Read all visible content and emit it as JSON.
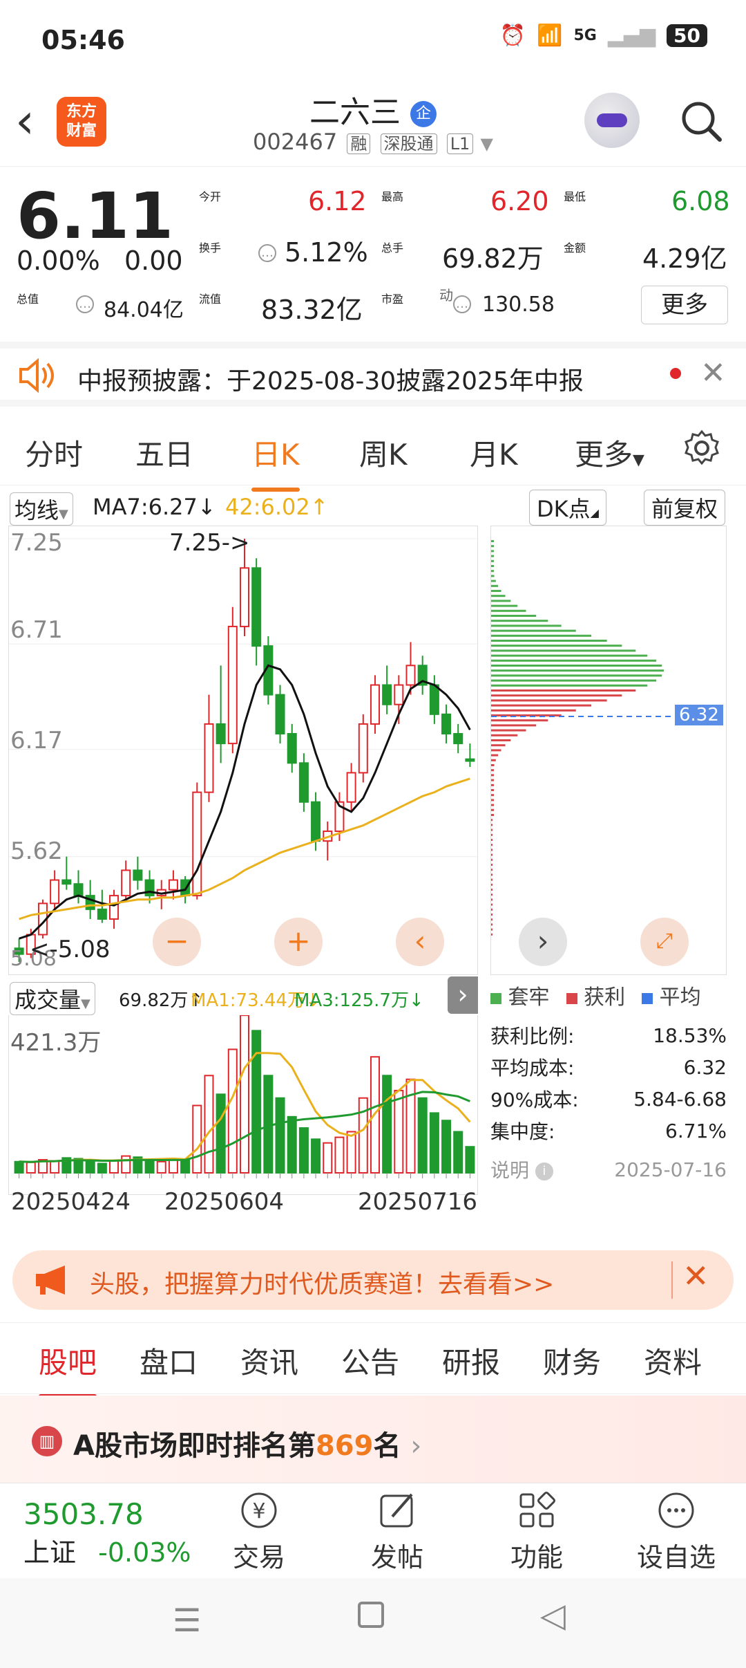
{
  "status": {
    "time": "05:46",
    "battery": "50",
    "network": "5G"
  },
  "header": {
    "back_icon": "back-chevron",
    "logo_text_1": "东方",
    "logo_text_2": "财富",
    "stock_name": "二六三",
    "stock_badge": "企",
    "code": "002467",
    "tags": [
      "融",
      "深股通",
      "L1"
    ]
  },
  "quote": {
    "price": "6.11",
    "change_pct": "0.00%",
    "change_val": "0.00",
    "open_label": "今开",
    "open": "6.12",
    "high_label": "最高",
    "high": "6.20",
    "low_label": "最低",
    "low": "6.08",
    "turnover_label": "换手",
    "turnover": "5.12%",
    "volume_label": "总手",
    "volume": "69.82万",
    "amount_label": "金额",
    "amount": "4.29亿",
    "mktcap_label": "总值",
    "mktcap": "84.04亿",
    "float_label": "流值",
    "float": "83.32亿",
    "pe_label": "市盈",
    "pe_sup": "动",
    "pe": "130.58",
    "more_label": "更多"
  },
  "notice": {
    "text": "中报预披露：于2025-08-30披露2025年中报"
  },
  "ktabs": [
    "分时",
    "五日",
    "日K",
    "周K",
    "月K",
    "更多"
  ],
  "ma_bar": {
    "selector": "均线",
    "ma7": "MA7:6.27",
    "ma7_arrow": "↓",
    "ma42": "42:6.02",
    "ma42_arrow": "↑",
    "dk_label": "DK点",
    "adj_label": "前复权"
  },
  "kchart": {
    "ticks": [
      "7.25",
      "6.71",
      "6.17",
      "5.62",
      "5.08"
    ],
    "high_mark": "7.25->",
    "low_mark": "<-5.08",
    "bottom_tick": "5.08"
  },
  "chart_data": [
    {
      "type": "candlestick",
      "title": "",
      "ylim": [
        5.08,
        7.25
      ],
      "dates_shown": [
        "20250424",
        "20250604",
        "20250716"
      ],
      "ohlc": [
        [
          5.15,
          5.2,
          5.08,
          5.12
        ],
        [
          5.12,
          5.25,
          5.1,
          5.22
        ],
        [
          5.22,
          5.4,
          5.2,
          5.38
        ],
        [
          5.38,
          5.55,
          5.35,
          5.5
        ],
        [
          5.5,
          5.62,
          5.45,
          5.48
        ],
        [
          5.48,
          5.55,
          5.38,
          5.42
        ],
        [
          5.42,
          5.5,
          5.3,
          5.35
        ],
        [
          5.35,
          5.45,
          5.28,
          5.3
        ],
        [
          5.3,
          5.45,
          5.25,
          5.42
        ],
        [
          5.42,
          5.6,
          5.4,
          5.55
        ],
        [
          5.55,
          5.62,
          5.45,
          5.5
        ],
        [
          5.5,
          5.55,
          5.38,
          5.42
        ],
        [
          5.42,
          5.5,
          5.35,
          5.45
        ],
        [
          5.45,
          5.55,
          5.4,
          5.5
        ],
        [
          5.5,
          5.52,
          5.38,
          5.42
        ],
        [
          5.42,
          6.0,
          5.4,
          5.95
        ],
        [
          5.95,
          6.45,
          5.9,
          6.3
        ],
        [
          6.3,
          6.6,
          6.1,
          6.2
        ],
        [
          6.2,
          6.9,
          6.15,
          6.8
        ],
        [
          6.8,
          7.25,
          6.75,
          7.1
        ],
        [
          7.1,
          7.15,
          6.6,
          6.7
        ],
        [
          6.7,
          6.75,
          6.4,
          6.45
        ],
        [
          6.45,
          6.5,
          6.2,
          6.25
        ],
        [
          6.25,
          6.3,
          6.05,
          6.1
        ],
        [
          6.1,
          6.15,
          5.85,
          5.9
        ],
        [
          5.9,
          5.95,
          5.65,
          5.7
        ],
        [
          5.7,
          5.8,
          5.6,
          5.75
        ],
        [
          5.75,
          5.95,
          5.7,
          5.9
        ],
        [
          5.9,
          6.1,
          5.85,
          6.05
        ],
        [
          6.05,
          6.35,
          6.0,
          6.3
        ],
        [
          6.3,
          6.55,
          6.25,
          6.5
        ],
        [
          6.5,
          6.6,
          6.35,
          6.4
        ],
        [
          6.4,
          6.55,
          6.3,
          6.5
        ],
        [
          6.5,
          6.72,
          6.45,
          6.6
        ],
        [
          6.6,
          6.65,
          6.45,
          6.5
        ],
        [
          6.5,
          6.55,
          6.3,
          6.35
        ],
        [
          6.35,
          6.4,
          6.2,
          6.25
        ],
        [
          6.25,
          6.3,
          6.15,
          6.2
        ],
        [
          6.12,
          6.2,
          6.08,
          6.11
        ]
      ],
      "ma7": [
        5.2,
        5.22,
        5.28,
        5.35,
        5.4,
        5.42,
        5.4,
        5.38,
        5.37,
        5.4,
        5.43,
        5.44,
        5.43,
        5.44,
        5.45,
        5.55,
        5.7,
        5.85,
        6.05,
        6.3,
        6.5,
        6.6,
        6.58,
        6.5,
        6.35,
        6.15,
        5.98,
        5.88,
        5.85,
        5.92,
        6.05,
        6.2,
        6.35,
        6.48,
        6.52,
        6.5,
        6.45,
        6.38,
        6.27
      ],
      "ma42": [
        5.3,
        5.32,
        5.33,
        5.34,
        5.35,
        5.36,
        5.37,
        5.37,
        5.38,
        5.39,
        5.4,
        5.4,
        5.41,
        5.41,
        5.42,
        5.43,
        5.45,
        5.48,
        5.51,
        5.55,
        5.58,
        5.61,
        5.64,
        5.66,
        5.68,
        5.7,
        5.72,
        5.74,
        5.76,
        5.78,
        5.81,
        5.84,
        5.87,
        5.9,
        5.93,
        5.95,
        5.98,
        6.0,
        6.02
      ]
    },
    {
      "type": "bar",
      "title": "成交量",
      "ylim": [
        0,
        421.3
      ],
      "unit": "万",
      "values": [
        30,
        28,
        35,
        32,
        40,
        38,
        30,
        25,
        33,
        45,
        42,
        35,
        30,
        38,
        36,
        180,
        260,
        210,
        330,
        421,
        380,
        260,
        200,
        150,
        120,
        90,
        80,
        95,
        110,
        200,
        310,
        260,
        220,
        250,
        200,
        160,
        140,
        110,
        69.82
      ]
    }
  ],
  "vol_bar": {
    "selector": "成交量",
    "vol": "69.82万",
    "vol_arrow": "↑",
    "ma1": "MA1:73.44万",
    "ma1_arrow": "↓",
    "ma3": "MA3:125.7万",
    "ma3_arrow": "↓",
    "top_value": "421.3万"
  },
  "chip": {
    "marker": "6.32",
    "legend": [
      "套牢",
      "获利",
      "平均"
    ],
    "rows": [
      {
        "label": "获利比例:",
        "value": "18.53%"
      },
      {
        "label": "平均成本:",
        "value": "6.32"
      },
      {
        "label": "90%成本:",
        "value": "5.84-6.68"
      },
      {
        "label": "集中度:",
        "value": "6.71%"
      }
    ],
    "note_label": "说明",
    "date": "2025-07-16"
  },
  "promo": {
    "text": "头股，把握算力时代优质赛道！去看看>>"
  },
  "btabs": [
    "股吧",
    "盘口",
    "资讯",
    "公告",
    "研报",
    "财务",
    "资料"
  ],
  "rank": {
    "prefix": "A股市场即时排名第",
    "number": "869",
    "suffix": "名"
  },
  "bottom_nav": {
    "index_value": "3503.78",
    "index_name": "上证",
    "index_change": "-0.03%",
    "items": [
      "交易",
      "发帖",
      "功能",
      "设自选"
    ]
  }
}
